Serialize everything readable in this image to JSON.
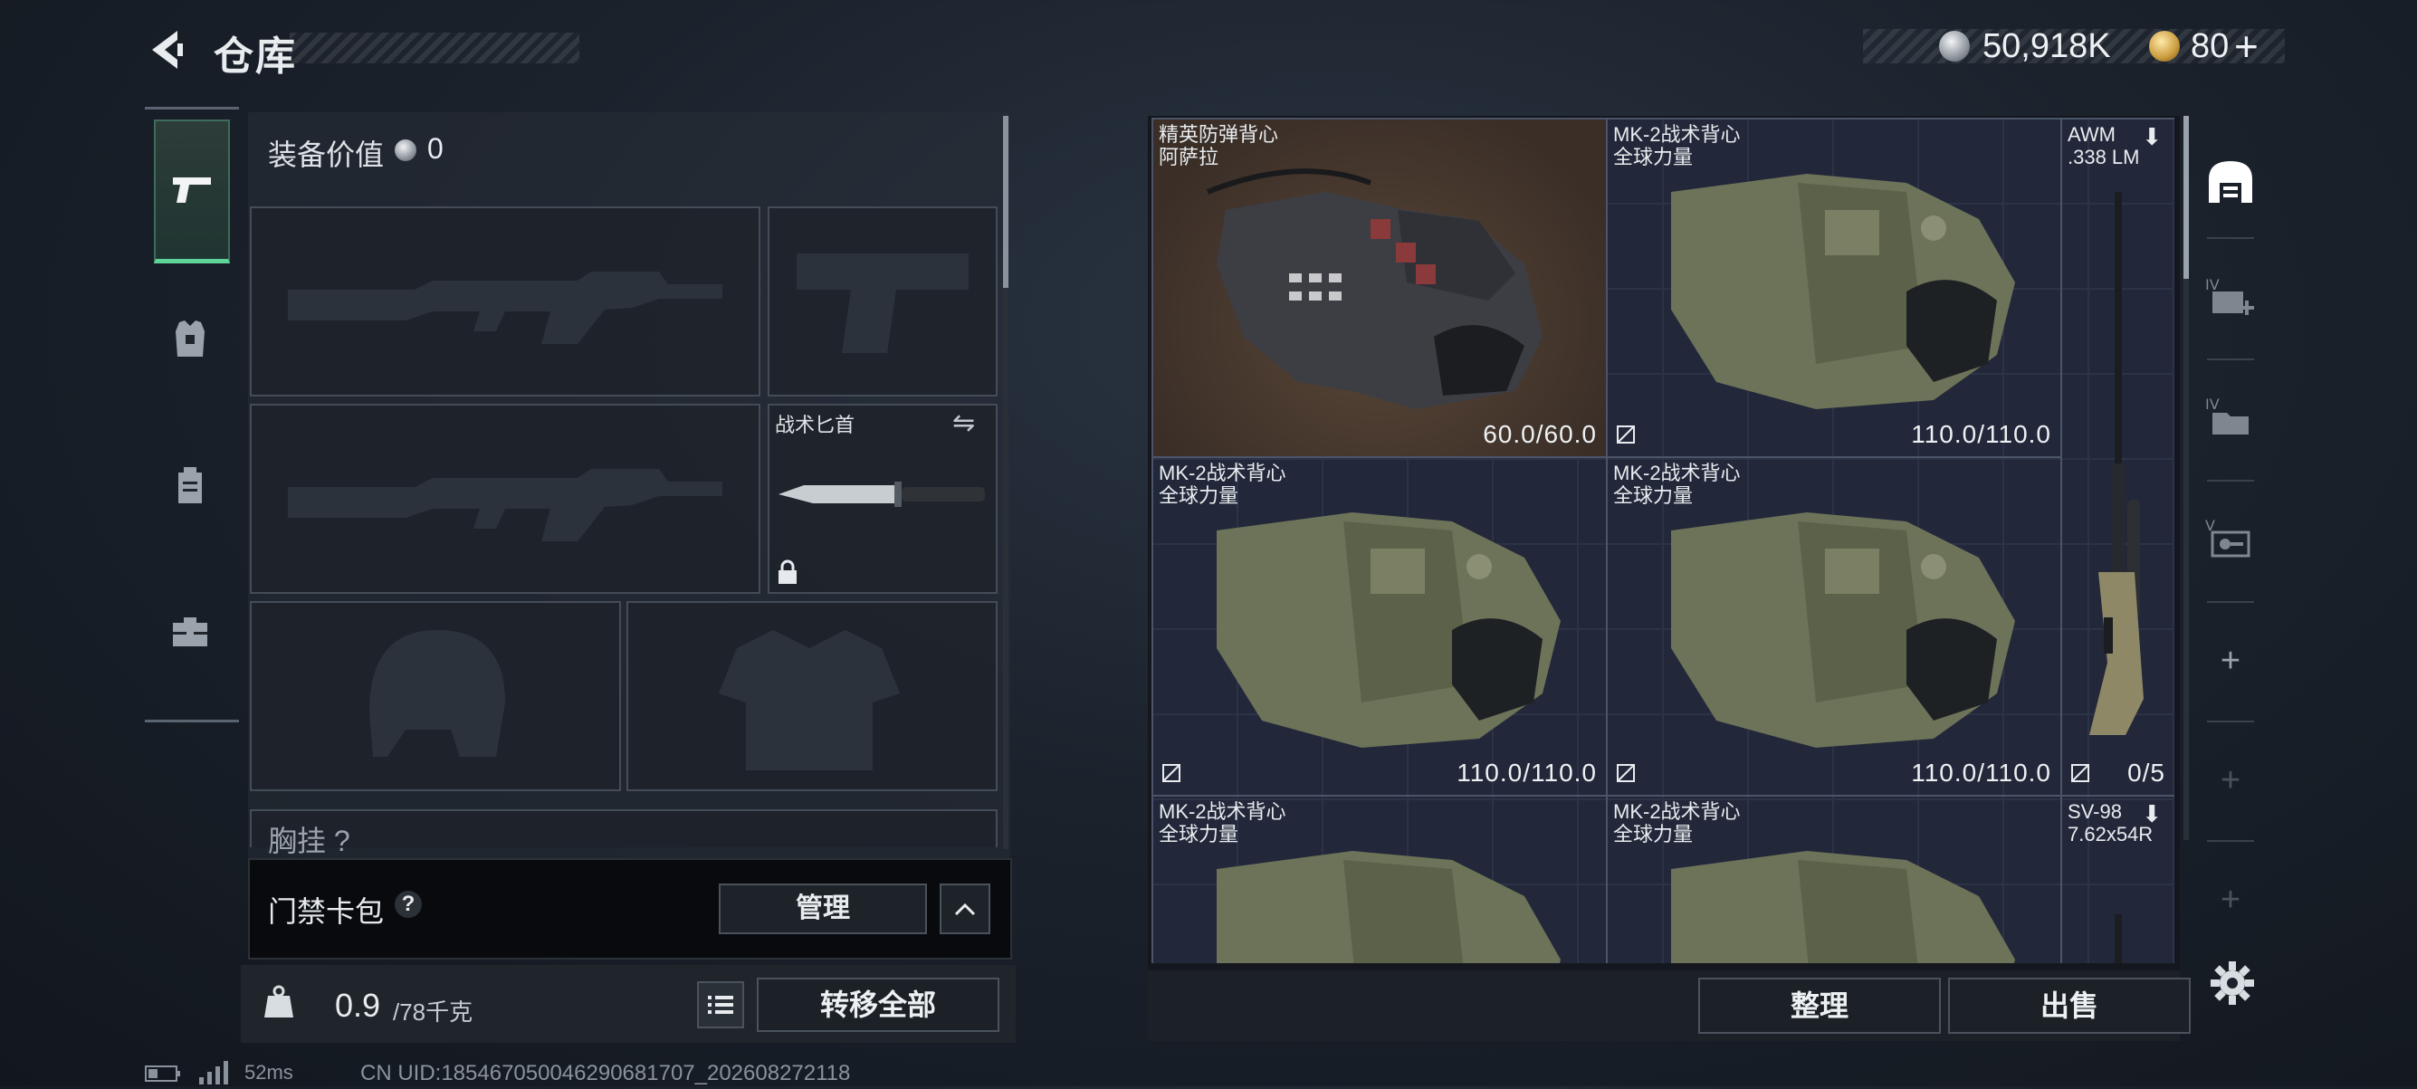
{
  "header": {
    "title": "仓库",
    "silver_amount": "50,918K",
    "gold_amount": "80",
    "gold_plus": "+"
  },
  "equipment": {
    "value_label": "装备价值",
    "value": "0",
    "melee_label": "战术匕首",
    "rig_label": "胸挂 ?"
  },
  "card_wallet": {
    "label": "门禁卡包",
    "help": "?",
    "manage_label": "管理"
  },
  "bottom_left": {
    "weight_current": "0.9",
    "weight_max": "/78千克",
    "transfer_all_label": "转移全部"
  },
  "status_line": {
    "ping": "52ms",
    "uid": "CN UID:185467050046290681707_202608272118"
  },
  "storage": {
    "items": [
      {
        "name": "精英防弹背心\n阿萨拉",
        "durability": "60.0/60.0"
      },
      {
        "name": "MK-2战术背心\n全球力量",
        "durability": "110.0/110.0"
      },
      {
        "name": "MK-2战术背心\n全球力量",
        "durability": "110.0/110.0"
      },
      {
        "name": "MK-2战术背心\n全球力量",
        "durability": "110.0/110.0"
      },
      {
        "name": "MK-2战术背心\n全球力量",
        "durability": ""
      },
      {
        "name": "MK-2战术背心\n全球力量",
        "durability": ""
      }
    ],
    "awm": {
      "name": "AWM\n.338 LM",
      "ammo": "0/5"
    },
    "sv98": {
      "name": "SV-98\n7.62x54R"
    },
    "sort_label": "整理",
    "sell_label": "出售"
  },
  "right_sidebar": {
    "add_symbol": "+"
  },
  "colors": {
    "accent_green": "#5fd49a",
    "panel_bg": "#20252c",
    "grid_bg": "#22283a"
  }
}
